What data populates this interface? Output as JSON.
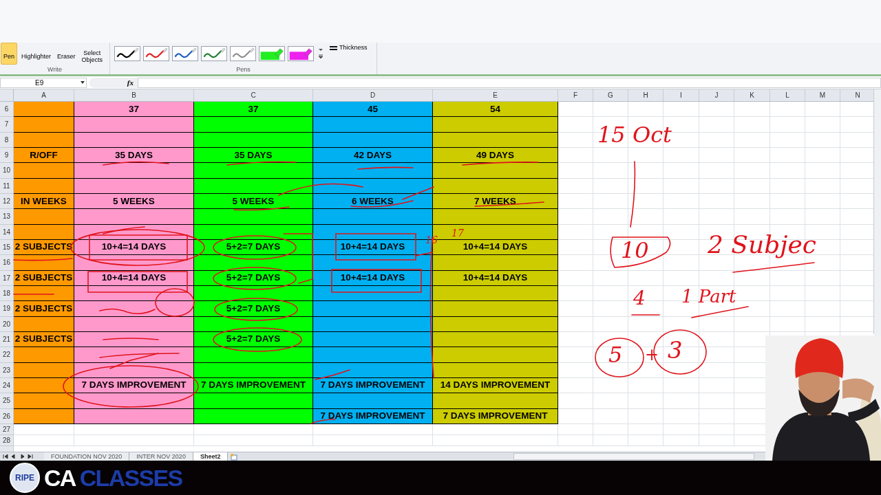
{
  "ribbon": {
    "write_group": {
      "label": "Write",
      "buttons": [
        {
          "label": "Pen",
          "selected": true
        },
        {
          "label": "Highlighter",
          "selected": false
        },
        {
          "label": "Eraser",
          "selected": false
        },
        {
          "label": "Select Objects",
          "selected": false
        }
      ]
    },
    "pens_group": {
      "label": "Pens",
      "pens": [
        {
          "kind": "pen",
          "color": "#000000"
        },
        {
          "kind": "pen",
          "color": "#e02020"
        },
        {
          "kind": "pen",
          "color": "#2060c0"
        },
        {
          "kind": "pen",
          "color": "#208030"
        },
        {
          "kind": "pen",
          "color": "#909090"
        },
        {
          "kind": "highlighter",
          "color": "#22ee22"
        },
        {
          "kind": "highlighter",
          "color": "#ee22ee"
        }
      ],
      "thickness_label": "Thickness"
    }
  },
  "formula_bar": {
    "name_box": "E9",
    "fx_label": "fx"
  },
  "columns": [
    {
      "letter": "A",
      "color": "#ff9900"
    },
    {
      "letter": "B",
      "color": "#ff99cc"
    },
    {
      "letter": "C",
      "color": "#00ff00"
    },
    {
      "letter": "D",
      "color": "#00b0f0"
    },
    {
      "letter": "E",
      "color": "#cccc00"
    },
    {
      "letter": "F"
    },
    {
      "letter": "G"
    },
    {
      "letter": "H"
    },
    {
      "letter": "I"
    },
    {
      "letter": "J"
    },
    {
      "letter": "K"
    },
    {
      "letter": "L"
    },
    {
      "letter": "M"
    },
    {
      "letter": "N"
    }
  ],
  "rows": [
    {
      "header": "6",
      "cells": {
        "b": "37",
        "c": "37",
        "d": "45",
        "e": "54"
      }
    },
    {
      "header": "7",
      "cells": {}
    },
    {
      "header": "8",
      "cells": {}
    },
    {
      "header": "9",
      "cells": {
        "a": "R/OFF",
        "b": "35 DAYS",
        "c": "35 DAYS",
        "d": "42 DAYS",
        "e": "49 DAYS"
      }
    },
    {
      "header": "10",
      "cells": {}
    },
    {
      "header": "11",
      "cells": {}
    },
    {
      "header": "12",
      "cells": {
        "a": "IN WEEKS",
        "b": "5 WEEKS",
        "c": "5 WEEKS",
        "d": "6 WEEKS",
        "e": "7 WEEKS"
      }
    },
    {
      "header": "13",
      "cells": {}
    },
    {
      "header": "14",
      "cells": {}
    },
    {
      "header": "15",
      "cells": {
        "a": "2 SUBJECTS",
        "b": "10+4=14 DAYS",
        "c": "5+2=7 DAYS",
        "d": "10+4=14 DAYS",
        "e": "10+4=14 DAYS"
      }
    },
    {
      "header": "16",
      "cells": {}
    },
    {
      "header": "17",
      "cells": {
        "a": "2 SUBJECTS",
        "b": "10+4=14 DAYS",
        "c": "5+2=7 DAYS",
        "d": "10+4=14 DAYS",
        "e": "10+4=14 DAYS"
      }
    },
    {
      "header": "18",
      "cells": {}
    },
    {
      "header": "19",
      "cells": {
        "a": "2 SUBJECTS",
        "c": "5+2=7 DAYS"
      }
    },
    {
      "header": "20",
      "cells": {}
    },
    {
      "header": "21",
      "cells": {
        "a": "2 SUBJECTS",
        "c": "5+2=7 DAYS"
      }
    },
    {
      "header": "22",
      "cells": {}
    },
    {
      "header": "23",
      "cells": {}
    },
    {
      "header": "24",
      "cells": {
        "b": "7 DAYS IMPROVEMENT",
        "c": "7 DAYS IMPROVEMENT",
        "d": "7 DAYS IMPROVEMENT",
        "e": "14 DAYS IMPROVEMENT"
      }
    },
    {
      "header": "25",
      "cells": {}
    },
    {
      "header": "26",
      "cells": {
        "d": "7 DAYS IMPROVEMENT",
        "e": "7 DAYS IMPROVEMENT"
      }
    }
  ],
  "blank_rows": [
    "27",
    "28"
  ],
  "handwritten_notes": [
    "15 Oct",
    "10",
    "2 Subjec",
    "4",
    "1 Part",
    "5",
    "+",
    "3",
    "16",
    "17"
  ],
  "sheet_tabs": [
    {
      "label": "FOUNDATION NOV 2020",
      "selected": false
    },
    {
      "label": "INTER NOV 2020",
      "selected": false
    },
    {
      "label": "Sheet2",
      "selected": true
    }
  ],
  "logo": {
    "badge": "RIPE",
    "first_word": "CA",
    "second_word": "CLASSES"
  },
  "presenter": {
    "kind": "picture"
  }
}
